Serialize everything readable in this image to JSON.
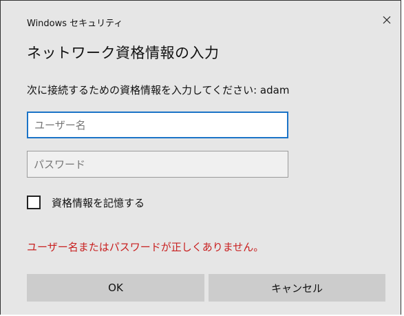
{
  "window": {
    "title": "Windows セキュリティ",
    "close_icon": "close-icon"
  },
  "dialog": {
    "heading": "ネットワーク資格情報の入力",
    "instruction": "次に接続するための資格情報を入力してください: adam"
  },
  "form": {
    "username_placeholder": "ユーザー名",
    "username_value": "",
    "password_placeholder": "パスワード",
    "password_value": "",
    "remember_label": "資格情報を記憶する",
    "remember_checked": false
  },
  "error": {
    "message": "ユーザー名またはパスワードが正しくありません。"
  },
  "buttons": {
    "ok_label": "OK",
    "cancel_label": "キャンセル"
  },
  "colors": {
    "background": "#e6e6e6",
    "accent": "#1a73c7",
    "error": "#c81e1e",
    "button": "#cccccc"
  }
}
